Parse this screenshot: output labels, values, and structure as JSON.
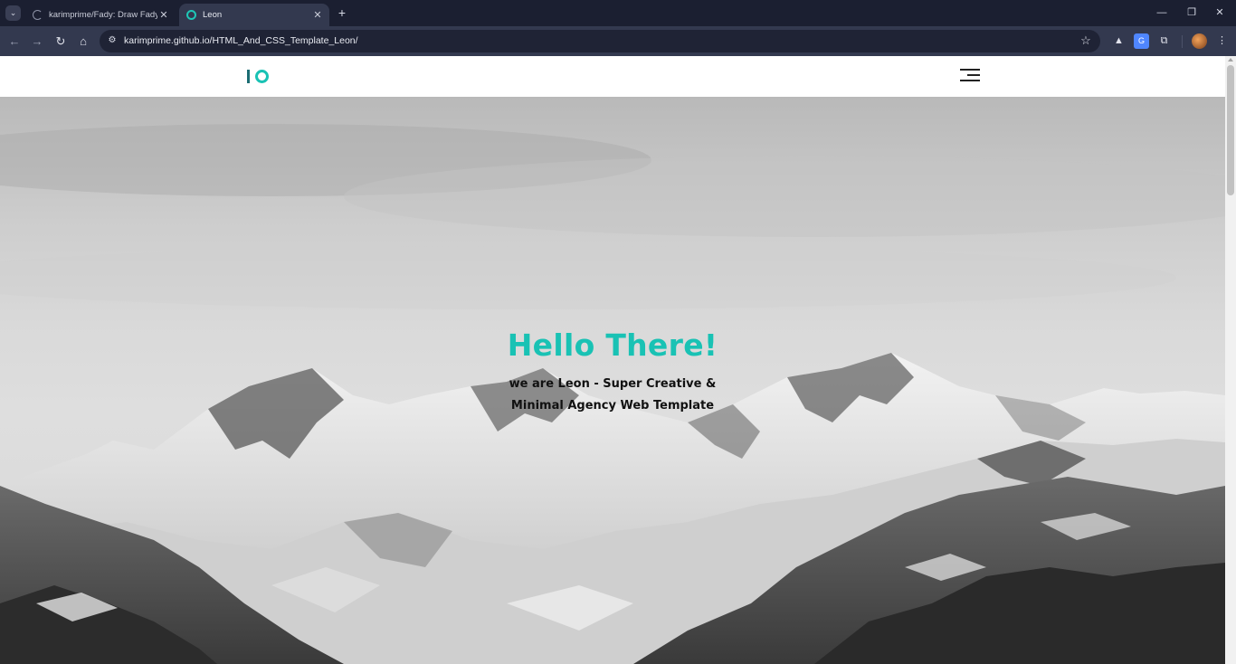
{
  "browser": {
    "tabs": [
      {
        "title": "karimprime/Fady: Draw Fady us",
        "active": false,
        "favicon": "loading-spinner-icon"
      },
      {
        "title": "Leon",
        "active": true,
        "favicon": "leon-circle-icon"
      }
    ],
    "close_glyph": "✕",
    "new_tab_glyph": "+",
    "window_controls": {
      "minimize": "—",
      "restore": "❐",
      "close": "✕"
    },
    "nav": {
      "back": "←",
      "forward": "→",
      "reload": "↻",
      "home": "⌂"
    },
    "address": {
      "host": "karimprime.github.io",
      "path": "/HTML_And_CSS_Template_Leon/"
    },
    "star_glyph": "☆",
    "extensions": [
      "triangle-extension-icon",
      "translate-extension-icon",
      "puzzle-extensions-icon",
      "profile-avatar"
    ],
    "menu_glyph": "⋮",
    "colors": {
      "tabbar": "#1b1f31",
      "toolbar": "#33394f",
      "omnibox": "#1f2335"
    }
  },
  "site": {
    "logo": {
      "accent": "#19c2b4",
      "bar_color": "#1c6d73"
    },
    "hero": {
      "title": "Hello There!",
      "subtitle": "we are Leon - Super Creative & Minimal Agency Web Template"
    },
    "colors": {
      "accent": "#19c2b4",
      "text": "#111111"
    }
  }
}
